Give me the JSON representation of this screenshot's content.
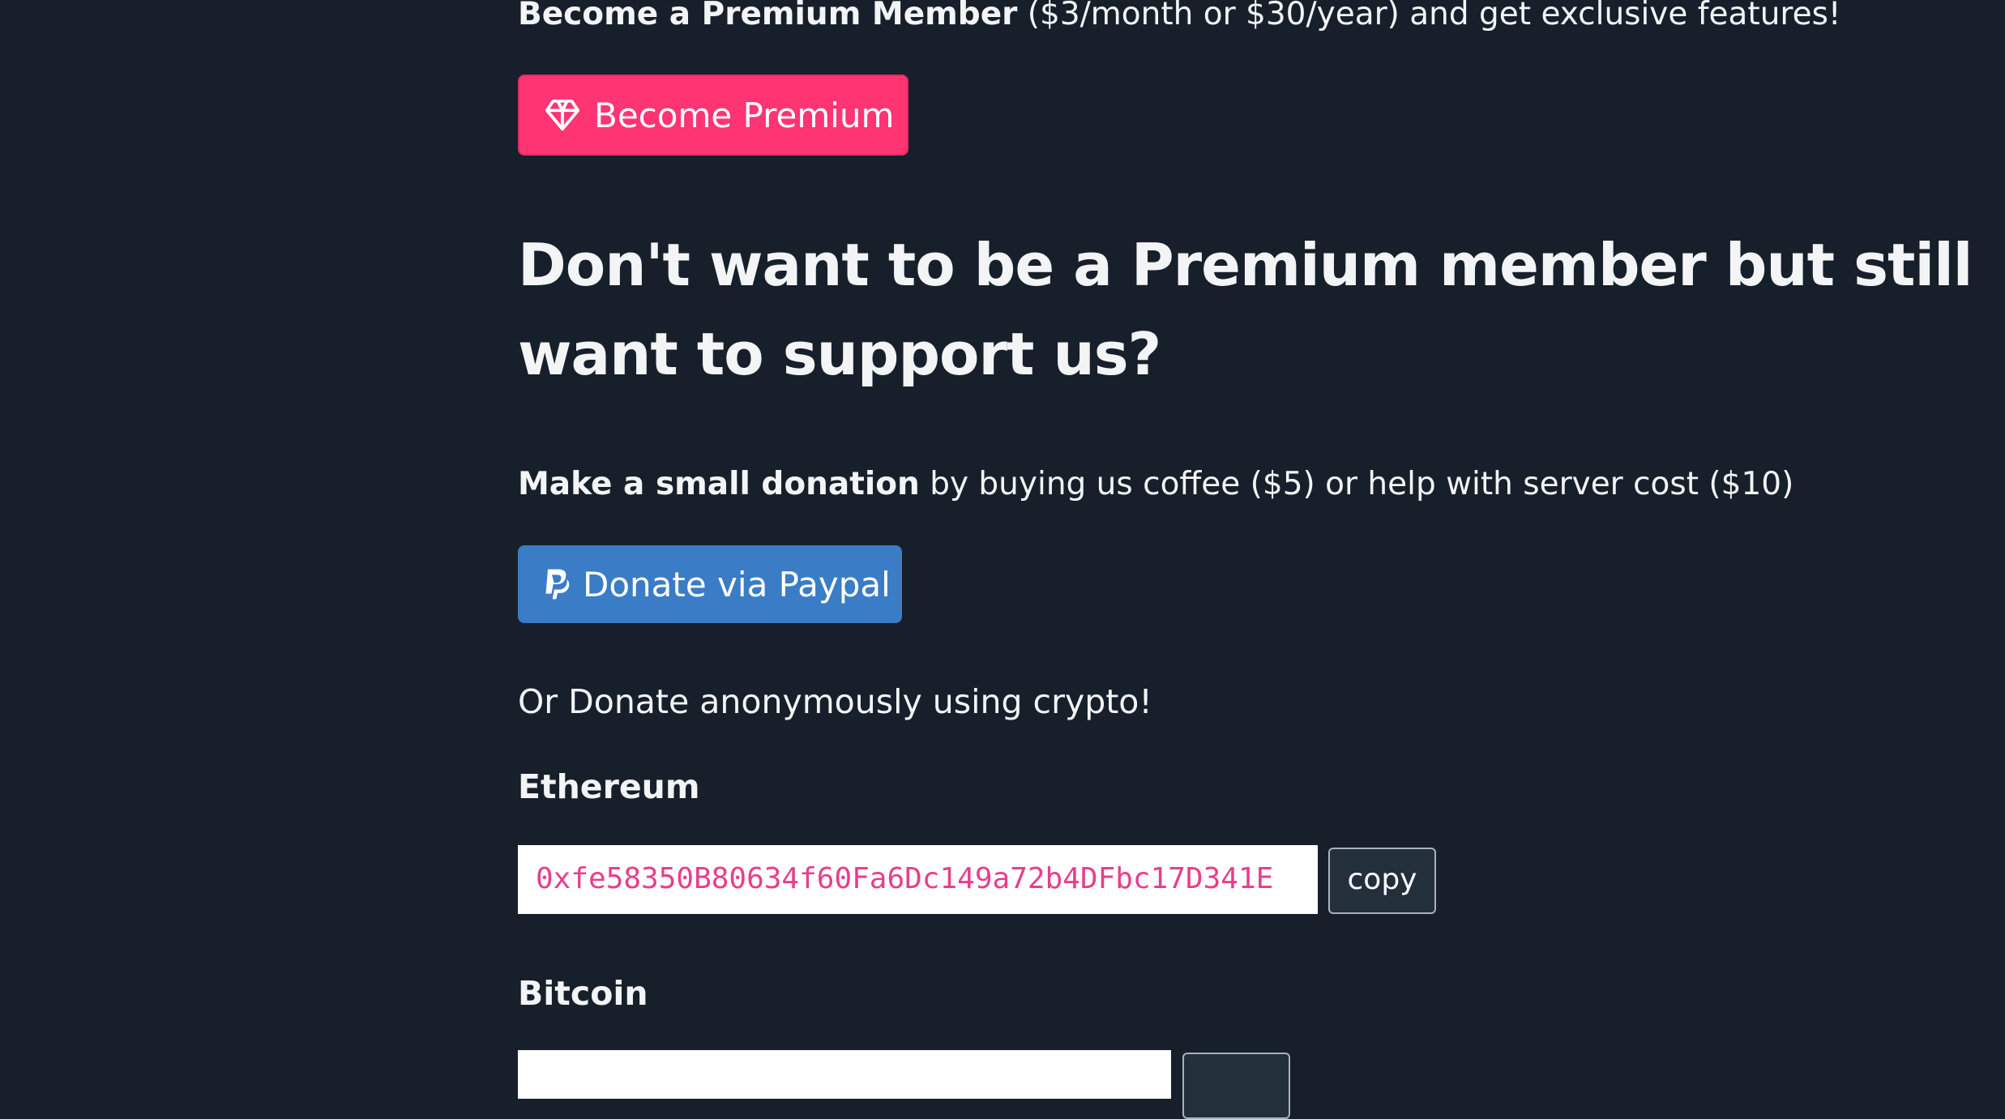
{
  "premium": {
    "lead_bold": "Become a Premium Member",
    "lead_rest": " ($3/month or $30/year) and get exclusive features!",
    "button_label": "Become Premium"
  },
  "support": {
    "heading": "Don't want to be a Premium member but still want to support us?",
    "donation_bold": "Make a small donation",
    "donation_rest": " by buying us coffee ($5) or help with server cost ($10)",
    "paypal_label": "Donate via Paypal"
  },
  "crypto": {
    "intro": "Or Donate anonymously using crypto!",
    "ethereum": {
      "label": "Ethereum",
      "address": "0xfe58350B80634f60Fa6Dc149a72b4DFbc17D341E",
      "copy_label": "copy"
    },
    "bitcoin": {
      "label": "Bitcoin",
      "address": "",
      "copy_label": ""
    }
  },
  "colors": {
    "background": "#17202a",
    "premium_button": "#ff3472",
    "paypal_button": "#3a7cc6",
    "address_text": "#e83e8c"
  },
  "icons": {
    "premium": "diamond-icon",
    "paypal": "paypal-icon"
  }
}
